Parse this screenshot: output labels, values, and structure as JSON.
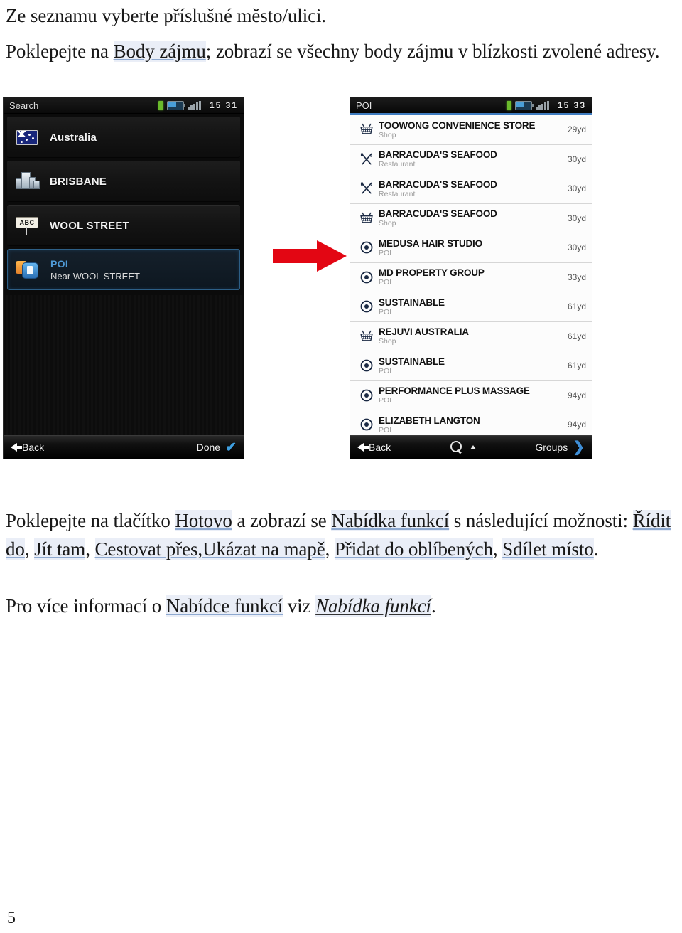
{
  "document": {
    "page_number": "5",
    "paragraphs": {
      "p1": {
        "text": "Ze seznamu vyberte příslušné město/ulici."
      },
      "p2": {
        "pre": "Poklepejte na ",
        "link1": "Body zájmu",
        "post": "; zobrazí se všechny body zájmu v blízkosti zvolené adresy."
      },
      "p3": {
        "s1": "Poklepejte na tlačítko ",
        "link_hotovo": "Hotovo",
        "s2": " a zobrazí se ",
        "link_nabidka": "Nabídka funkcí",
        "s3": " s následující možnosti: ",
        "link_ridit": "Řídit do",
        "s4": ", ",
        "link_jit": "Jít tam",
        "s5": ", ",
        "link_cestovat": "Cestovat přes,Ukázat na mapě",
        "s6": ", ",
        "link_pridat": "Přidat do oblíbených",
        "s7": ", ",
        "link_sdilet": "Sdílet místo",
        "s8": "."
      },
      "p4": {
        "s1": "Pro více informací o ",
        "link_nabidce": "Nabídce funkcí",
        "s2": " viz ",
        "link_italic": "Nabídka funkcí",
        "s3": "."
      }
    }
  },
  "colors": {
    "accent_blue": "#3f7cc0",
    "link_underline": "#8ea9d0",
    "link_highlight": "#eaeef7",
    "arrow_red": "#e30613",
    "selected_row_border": "#2d5f86",
    "poi_blue_text": "#4f9ad6"
  },
  "left_panel": {
    "statusbar": {
      "title": "Search",
      "time": "15 31",
      "icons": [
        "usb-icon",
        "battery-icon",
        "signal-bars-icon"
      ]
    },
    "rows": [
      {
        "icon": "australia-flag-icon",
        "label": "Australia"
      },
      {
        "icon": "city-buildings-icon",
        "label": "BRISBANE"
      },
      {
        "icon": "abc-street-sign-icon",
        "label": "WOOL STREET"
      },
      {
        "icon": "poi-marker-icon",
        "label": "POI",
        "sub": "Near WOOL STREET",
        "selected": true
      }
    ],
    "bottombar": {
      "back_label": "Back",
      "back_icon": "arrow-left-icon",
      "done_label": "Done",
      "done_icon": "checkmark-icon"
    }
  },
  "right_panel": {
    "statusbar": {
      "title": "POI",
      "time": "15 33",
      "icons": [
        "usb-icon",
        "battery-icon",
        "signal-bars-icon"
      ]
    },
    "rows": [
      {
        "icon": "shopping-basket-icon",
        "name": "TOOWONG CONVENIENCE STORE",
        "category": "Shop",
        "distance": "29yd"
      },
      {
        "icon": "cutlery-icon",
        "name": "BARRACUDA'S SEAFOOD",
        "category": "Restaurant",
        "distance": "30yd"
      },
      {
        "icon": "cutlery-icon",
        "name": "BARRACUDA'S SEAFOOD",
        "category": "Restaurant",
        "distance": "30yd"
      },
      {
        "icon": "shopping-basket-icon",
        "name": "BARRACUDA'S SEAFOOD",
        "category": "Shop",
        "distance": "30yd"
      },
      {
        "icon": "target-icon",
        "name": "MEDUSA HAIR STUDIO",
        "category": "POI",
        "distance": "30yd"
      },
      {
        "icon": "target-icon",
        "name": "MD PROPERTY GROUP",
        "category": "POI",
        "distance": "33yd"
      },
      {
        "icon": "target-icon",
        "name": "SUSTAINABLE",
        "category": "POI",
        "distance": "61yd"
      },
      {
        "icon": "shopping-basket-icon",
        "name": "REJUVI AUSTRALIA",
        "category": "Shop",
        "distance": "61yd"
      },
      {
        "icon": "target-icon",
        "name": "SUSTAINABLE",
        "category": "POI",
        "distance": "61yd"
      },
      {
        "icon": "target-icon",
        "name": "PERFORMANCE PLUS MASSAGE",
        "category": "POI",
        "distance": "94yd"
      },
      {
        "icon": "target-icon",
        "name": "ELIZABETH LANGTON",
        "category": "POI",
        "distance": "94yd"
      }
    ],
    "bottombar": {
      "back_label": "Back",
      "back_icon": "arrow-left-icon",
      "search_icon": "magnifier-up-icon",
      "groups_label": "Groups",
      "groups_icon": "chevron-right-icon"
    }
  },
  "annotation": {
    "arrow": "red-right-arrow"
  }
}
